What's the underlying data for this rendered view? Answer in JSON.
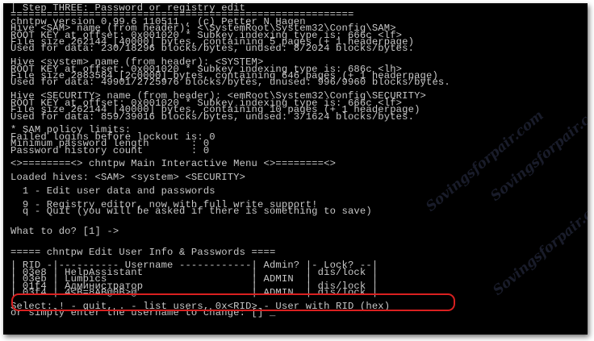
{
  "terminal": {
    "lines": [
      "| Step THREE: Password or registry edit",
      "=========================================================",
      "chntpw version 0.99.6 110511 , (c) Petter N Hagen",
      "Hive <SAM> name (from header): <\\SystemRoot\\System32\\Config\\SAM>",
      "ROOT KEY at offset: 0x001020 * Subkey indexing type is: 666c <lf>",
      "File size 262144 [40000] bytes, containing 5 pages (+ 1 headerpage)",
      "Used for data: 230/18296 blocks/bytes, unused: 8/2024 blocks/bytes.",
      "",
      "Hive <system> name (from header): <SYSTEM>",
      "ROOT KEY at offset: 0x001020 * Subkey indexing type is: 686c <lh>",
      "File size 2883584 [2c0000] bytes, containing 646 pages (+ 1 headerpage)",
      "Used for data: 49901/2725976 blocks/bytes, unused: 996/9960 blocks/bytes.",
      "",
      "Hive <SECURITY> name (from header): <emRoot\\System32\\Config\\SECURITY>",
      "ROOT KEY at offset: 0x001020 * Subkey indexing type is: 666c <lf>",
      "File size 262144 [40000] bytes, containing 10 pages (+ 1 headerpage)",
      "Used for data: 859/39016 blocks/bytes, unused: 3/1624 blocks/bytes.",
      "",
      "* SAM policy limits:",
      "Failed logins before lockout is: 0",
      "Minimum password length       : 0",
      "Password history count        : 0",
      "",
      "<>========<> chntpw Main Interactive Menu <>========<>",
      "",
      "Loaded hives: <SAM> <system> <SECURITY>",
      "",
      "  1 - Edit user data and passwords",
      "",
      "  9 - Registry editor, now with full write support!",
      "  q - Quit (you will be asked if there is something to save)",
      "",
      "",
      "What to do? [1] ->",
      "",
      "",
      "===== chntpw Edit User Info & Passwords ====",
      "",
      "| RID -|---------- Username ------------| Admin? |- Lock? --|",
      "| 03e8 | HelpAssistant                  |        | dis/lock |",
      "| 03eb | Lumpics                        | ADMIN  |          |",
      "| 01f4 | Администратор                  |        | dis/lock |",
      "| 03f4 | 4≤B=8AB@0B>@                   | ADMIN  | dis/lock |",
      "",
      "Select: ! - quit, . - list users, 0x<RID> - User with RID (hex)",
      "or simply enter the username to change: [] _"
    ]
  },
  "highlight": {
    "color": "#d92020",
    "row": "| 03f4 | 4≤B=8AB@0B>@                   | ADMIN  | dis/lock |"
  },
  "watermarks": [
    "Sovingsforpair.com",
    "Sovingsforpair.com",
    "Sovingsforpair.com"
  ]
}
